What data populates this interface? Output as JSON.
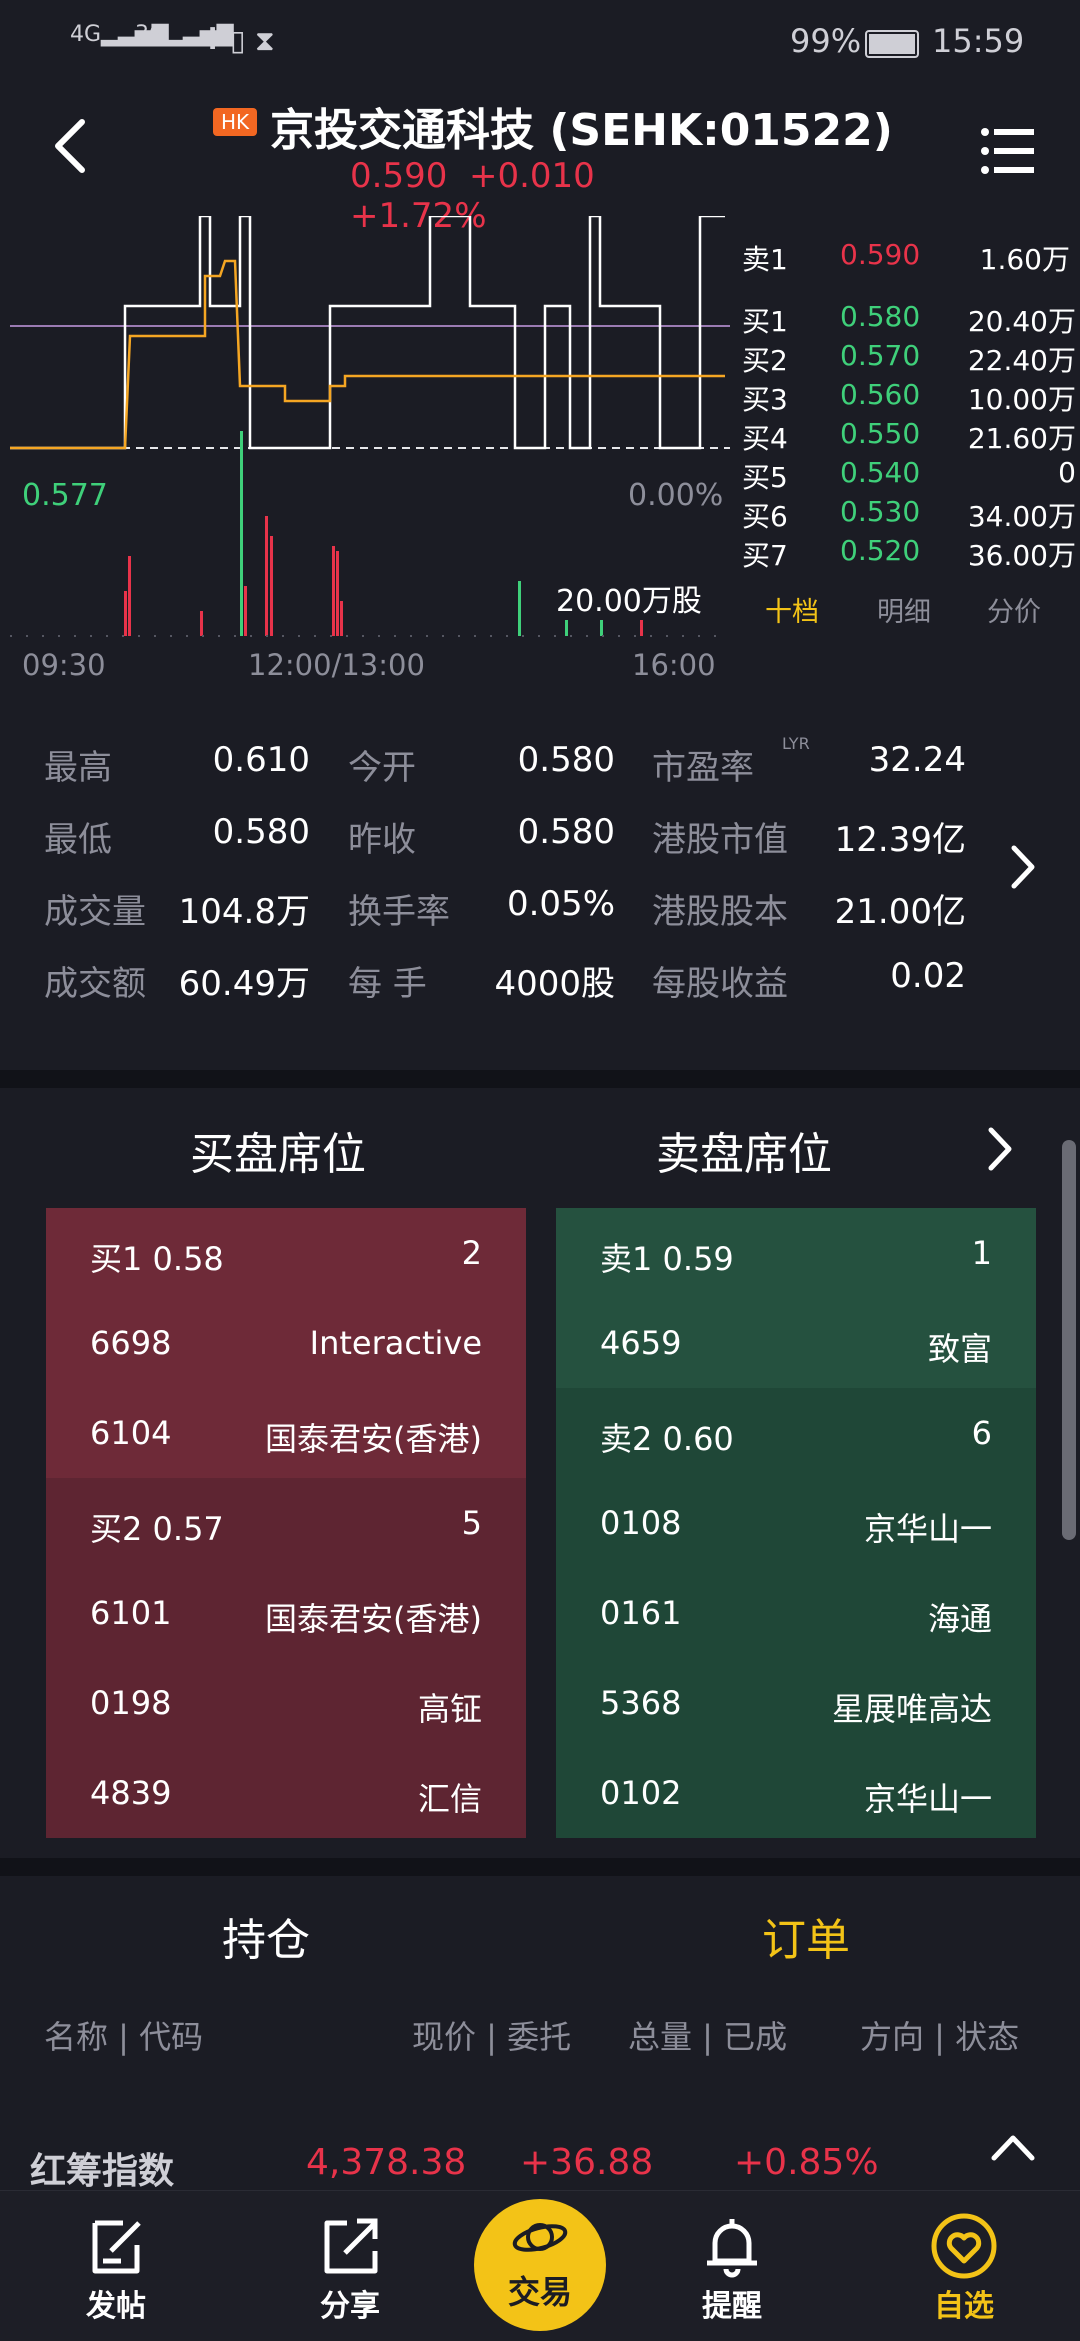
{
  "status_bar": {
    "net1": "4G",
    "net2": "3G",
    "battery_pct": "99%",
    "time": "15:59"
  },
  "header": {
    "badge": "HK",
    "title": "京投交通科技 (SEHK:01522)",
    "price": "0.590",
    "change": "+0.010",
    "change_pct": "+1.72%"
  },
  "chart": {
    "avg_price_label": "0.577",
    "pct_label": "0.00%",
    "volume_label": "20.00万股",
    "time_labels": [
      "09:30",
      "12:00/13:00",
      "16:00"
    ]
  },
  "order_book": {
    "asks": [
      {
        "label": "卖1",
        "price": "0.590",
        "vol": "1.60万"
      }
    ],
    "bids": [
      {
        "label": "买1",
        "price": "0.580",
        "vol": "20.40万"
      },
      {
        "label": "买2",
        "price": "0.570",
        "vol": "22.40万"
      },
      {
        "label": "买3",
        "price": "0.560",
        "vol": "10.00万"
      },
      {
        "label": "买4",
        "price": "0.550",
        "vol": "21.60万"
      },
      {
        "label": "买5",
        "price": "0.540",
        "vol": "0"
      },
      {
        "label": "买6",
        "price": "0.530",
        "vol": "34.00万"
      },
      {
        "label": "买7",
        "price": "0.520",
        "vol": "36.00万"
      }
    ],
    "tabs": [
      "十档",
      "明细",
      "分价"
    ]
  },
  "stats": [
    [
      {
        "label": "最高",
        "value": "0.610"
      },
      {
        "label": "今开",
        "value": "0.580"
      },
      {
        "label": "市盈率",
        "sup": "LYR",
        "value": "32.24"
      }
    ],
    [
      {
        "label": "最低",
        "value": "0.580"
      },
      {
        "label": "昨收",
        "value": "0.580"
      },
      {
        "label": "港股市值",
        "value": "12.39亿"
      }
    ],
    [
      {
        "label": "成交量",
        "value": "104.8万"
      },
      {
        "label": "换手率",
        "value": "0.05%"
      },
      {
        "label": "港股股本",
        "value": "21.00亿"
      }
    ],
    [
      {
        "label": "成交额",
        "value": "60.49万"
      },
      {
        "label": "每 手",
        "value": "4000股"
      },
      {
        "label": "每股收益",
        "value": "0.02"
      }
    ]
  ],
  "seats": {
    "buy_title": "买盘席位",
    "sell_title": "卖盘席位",
    "buy_rows": [
      {
        "l": "买1   0.58",
        "r": "2",
        "tone": "dark"
      },
      {
        "l": "6698",
        "r": "Interactive",
        "tone": "dark"
      },
      {
        "l": "6104",
        "r": "国泰君安(香港)",
        "tone": "dark"
      },
      {
        "l": "买2   0.57",
        "r": "5",
        "tone": "mid"
      },
      {
        "l": "6101",
        "r": "国泰君安(香港)",
        "tone": "mid"
      },
      {
        "l": "0198",
        "r": "高钲",
        "tone": "mid"
      },
      {
        "l": "4839",
        "r": "汇信",
        "tone": "mid"
      }
    ],
    "sell_rows": [
      {
        "l": "卖1   0.59",
        "r": "1",
        "tone": "dark"
      },
      {
        "l": "4659",
        "r": "致富",
        "tone": "dark"
      },
      {
        "l": "卖2   0.60",
        "r": "6",
        "tone": "mid"
      },
      {
        "l": "0108",
        "r": "京华山一",
        "tone": "mid"
      },
      {
        "l": "0161",
        "r": "海通",
        "tone": "mid"
      },
      {
        "l": "5368",
        "r": "星展唯高达",
        "tone": "mid"
      },
      {
        "l": "0102",
        "r": "京华山一",
        "tone": "mid"
      }
    ]
  },
  "positions": {
    "tab_holdings": "持仓",
    "tab_orders": "订单",
    "col_name": "名称 | 代码",
    "col_price": "现价 | 委托",
    "col_qty": "总量 | 已成",
    "col_dir": "方向 | 状态"
  },
  "ticker": {
    "name": "红筹指数",
    "value": "4,378.38",
    "change": "+36.88",
    "pct": "+0.85%"
  },
  "nav": {
    "post": "发帖",
    "share": "分享",
    "trade": "交易",
    "alert": "提醒",
    "watch": "自选"
  },
  "colors": {
    "up": "#e8334a",
    "down": "#3fd07a",
    "accent": "#f3c317"
  }
}
